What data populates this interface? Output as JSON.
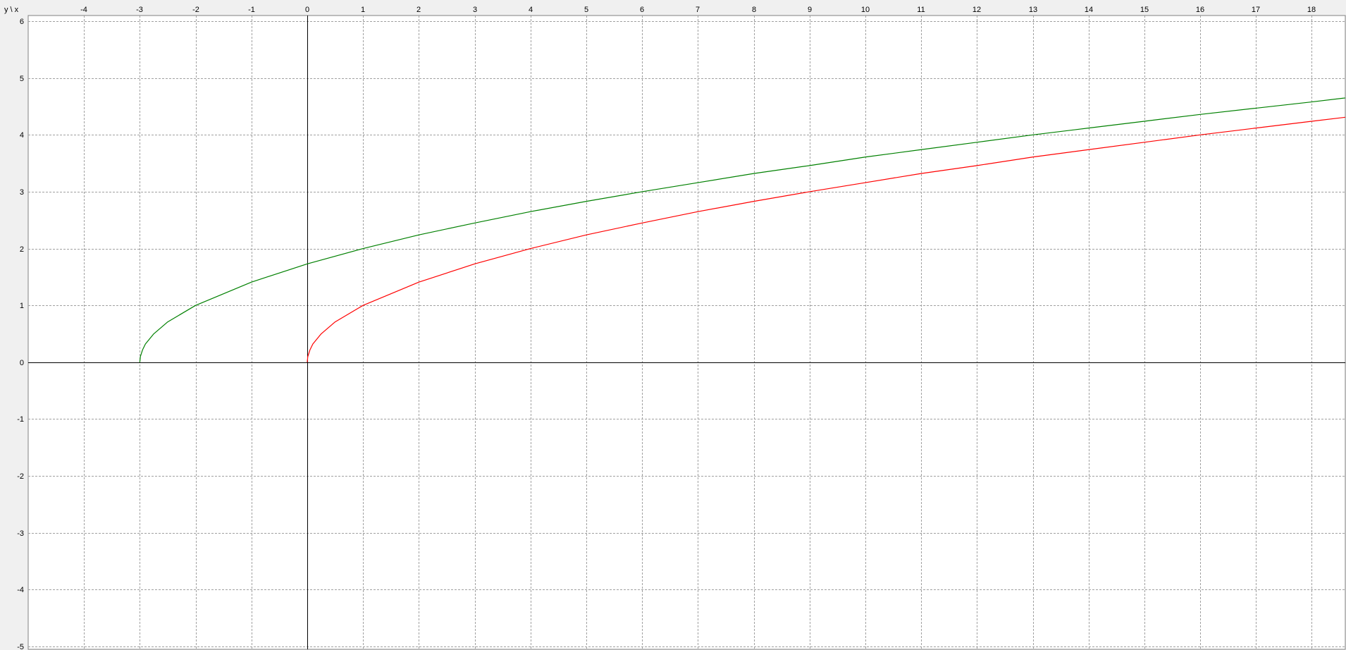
{
  "corner_label": "y \\ x",
  "colors": {
    "background": "#ffffff",
    "frame_background": "#f0f0f0",
    "grid": "#a0a0a0",
    "axis": "#000000",
    "series_red": "#ff0000",
    "series_green": "#008000"
  },
  "chart_data": {
    "type": "line",
    "title": "",
    "xlabel": "x",
    "ylabel": "y",
    "xlim": [
      -5,
      18.6
    ],
    "ylim": [
      -5.05,
      6.1
    ],
    "x_ticks": [
      -4,
      -3,
      -2,
      -1,
      0,
      1,
      2,
      3,
      4,
      5,
      6,
      7,
      8,
      9,
      10,
      11,
      12,
      13,
      14,
      15,
      16,
      17,
      18
    ],
    "x_tick_labels": [
      "-4",
      "-3",
      "-2",
      "-1",
      "0",
      "1",
      "2",
      "3",
      "4",
      "5",
      "6",
      "7",
      "8",
      "9",
      "10",
      "11",
      "12",
      "13",
      "14",
      "15",
      "16",
      "17",
      "18"
    ],
    "y_ticks": [
      6,
      5,
      4,
      3,
      2,
      1,
      0,
      -1,
      -2,
      -3,
      -4,
      -5
    ],
    "y_tick_labels": [
      "6",
      "5",
      "4",
      "3",
      "2",
      "1",
      "0",
      "-1",
      "-2",
      "-3",
      "-4",
      "-5"
    ],
    "grid": true,
    "legend": "none",
    "series": [
      {
        "color": "red",
        "x": [
          0,
          0.01,
          0.05,
          0.1,
          0.25,
          0.5,
          1,
          2,
          3,
          4,
          5,
          6,
          7,
          8,
          9,
          10,
          11,
          12,
          13,
          14,
          15,
          16,
          17,
          18,
          18.6
        ],
        "y": [
          0,
          0.1,
          0.22,
          0.32,
          0.5,
          0.71,
          1,
          1.41,
          1.73,
          2,
          2.24,
          2.45,
          2.65,
          2.83,
          3,
          3.16,
          3.32,
          3.46,
          3.61,
          3.74,
          3.87,
          4,
          4.12,
          4.24,
          4.31
        ]
      },
      {
        "color": "green",
        "x": [
          -3,
          -2.99,
          -2.95,
          -2.9,
          -2.75,
          -2.5,
          -2,
          -1,
          0,
          1,
          2,
          3,
          4,
          5,
          6,
          7,
          8,
          9,
          10,
          11,
          12,
          13,
          14,
          15,
          16,
          17,
          18,
          18.6
        ],
        "y": [
          0,
          0.1,
          0.22,
          0.32,
          0.5,
          0.71,
          1,
          1.41,
          1.73,
          2,
          2.24,
          2.45,
          2.65,
          2.83,
          3,
          3.16,
          3.32,
          3.46,
          3.61,
          3.74,
          3.87,
          4,
          4.12,
          4.24,
          4.36,
          4.47,
          4.58,
          4.65
        ]
      }
    ]
  }
}
